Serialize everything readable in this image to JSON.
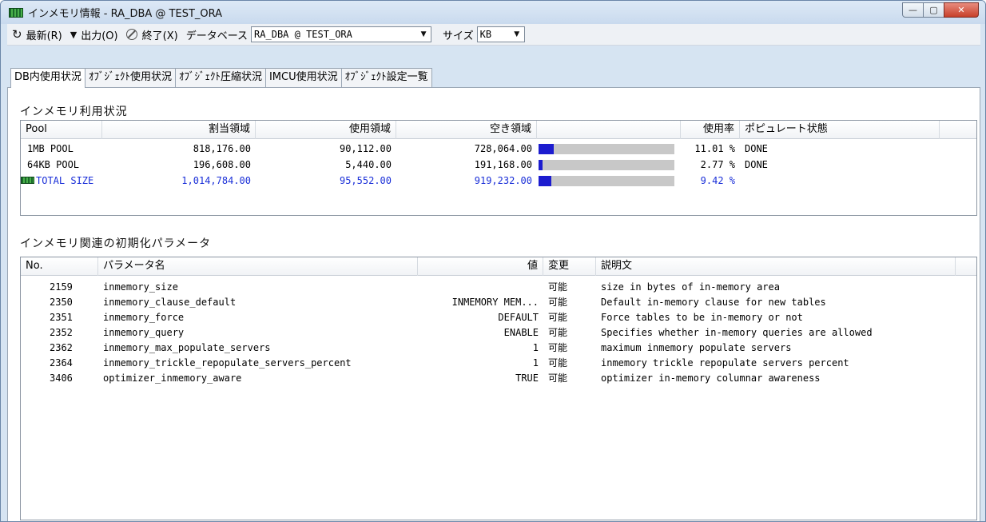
{
  "window": {
    "title": "インメモリ情報 - RA_DBA @ TEST_ORA"
  },
  "toolbar": {
    "refresh_label": "最新(R)",
    "output_label": "出力(O)",
    "exit_label": "終了(X)",
    "database_label": "データベース",
    "database_value": "RA_DBA @ TEST_ORA",
    "size_label": "サイズ",
    "size_value": "KB"
  },
  "tabs": [
    {
      "label": "DB内使用状況",
      "active": true
    },
    {
      "label": "ｵﾌﾞｼﾞｪｸﾄ使用状況",
      "active": false
    },
    {
      "label": "ｵﾌﾞｼﾞｪｸﾄ圧縮状況",
      "active": false
    },
    {
      "label": "IMCU使用状況",
      "active": false
    },
    {
      "label": "ｵﾌﾞｼﾞｪｸﾄ設定一覧",
      "active": false
    }
  ],
  "usage": {
    "title": "インメモリ利用状況",
    "columns": [
      "Pool",
      "割当領域",
      "使用領域",
      "空き領域",
      "",
      "使用率",
      "ポピュレート状態"
    ],
    "rows": [
      {
        "pool": "1MB POOL",
        "allocated": "818,176.00",
        "used": "90,112.00",
        "free": "728,064.00",
        "rate": "11.01 %",
        "usage_fraction": 0.1101,
        "status": "DONE",
        "total": false
      },
      {
        "pool": "64KB POOL",
        "allocated": "196,608.00",
        "used": "5,440.00",
        "free": "191,168.00",
        "rate": "2.77 %",
        "usage_fraction": 0.0277,
        "status": "DONE",
        "total": false
      },
      {
        "pool": "TOTAL SIZE",
        "allocated": "1,014,784.00",
        "used": "95,552.00",
        "free": "919,232.00",
        "rate": "9.42 %",
        "usage_fraction": 0.0942,
        "status": "",
        "total": true
      }
    ]
  },
  "params": {
    "title": "インメモリ関連の初期化パラメータ",
    "columns": [
      "No.",
      "パラメータ名",
      "値",
      "変更",
      "説明文"
    ],
    "rows": [
      {
        "no": "2159",
        "name": "inmemory_size",
        "value": "",
        "change": "可能",
        "desc": "size in bytes of in-memory area"
      },
      {
        "no": "2350",
        "name": "inmemory_clause_default",
        "value": "INMEMORY MEM...",
        "change": "可能",
        "desc": "Default in-memory clause for new tables"
      },
      {
        "no": "2351",
        "name": "inmemory_force",
        "value": "DEFAULT",
        "change": "可能",
        "desc": "Force tables to be in-memory or not"
      },
      {
        "no": "2352",
        "name": "inmemory_query",
        "value": "ENABLE",
        "change": "可能",
        "desc": "Specifies whether in-memory queries are allowed"
      },
      {
        "no": "2362",
        "name": "inmemory_max_populate_servers",
        "value": "1",
        "change": "可能",
        "desc": "maximum inmemory populate servers"
      },
      {
        "no": "2364",
        "name": "inmemory_trickle_repopulate_servers_percent",
        "value": "1",
        "change": "可能",
        "desc": "inmemory trickle repopulate servers percent"
      },
      {
        "no": "3406",
        "name": "optimizer_inmemory_aware",
        "value": "TRUE",
        "change": "可能",
        "desc": "optimizer in-memory columnar awareness"
      }
    ]
  }
}
